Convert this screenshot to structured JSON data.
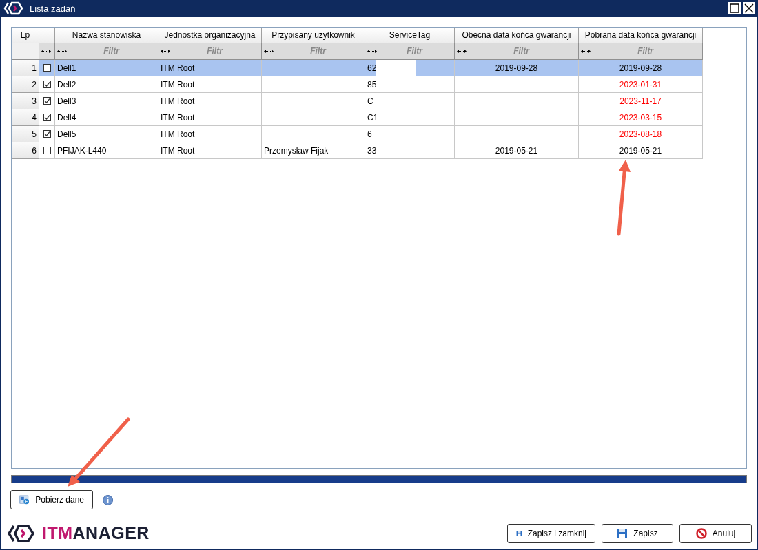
{
  "window": {
    "title": "Lista zadań"
  },
  "table": {
    "columns": [
      "Lp",
      "Nazwa stanowiska",
      "Jednostka organizacyjna",
      "Przypisany użytkownik",
      "ServiceTag",
      "Obecna data końca gwarancji",
      "Pobrana data końca gwarancji"
    ],
    "filter_placeholders": [
      "Filtr",
      "Filtr",
      "Filtr",
      "Filtr",
      "Filtr",
      "Filtr"
    ],
    "rows": [
      {
        "lp": "1",
        "checked": false,
        "selected": true,
        "name": "Dell1",
        "org": "ITM Root",
        "user": "",
        "tag": "62",
        "current": "2019-09-28",
        "fetched": "2019-09-28",
        "fetched_changed": false
      },
      {
        "lp": "2",
        "checked": true,
        "selected": false,
        "name": "Dell2",
        "org": "ITM Root",
        "user": "",
        "tag": "85",
        "current": "",
        "fetched": "2023-01-31",
        "fetched_changed": true
      },
      {
        "lp": "3",
        "checked": true,
        "selected": false,
        "name": "Dell3",
        "org": "ITM Root",
        "user": "",
        "tag": "C",
        "current": "",
        "fetched": "2023-11-17",
        "fetched_changed": true
      },
      {
        "lp": "4",
        "checked": true,
        "selected": false,
        "name": "Dell4",
        "org": "ITM Root",
        "user": "",
        "tag": "C1",
        "current": "",
        "fetched": "2023-03-15",
        "fetched_changed": true
      },
      {
        "lp": "5",
        "checked": true,
        "selected": false,
        "name": "Dell5",
        "org": "ITM Root",
        "user": "",
        "tag": "6",
        "current": "",
        "fetched": "2023-08-18",
        "fetched_changed": true
      },
      {
        "lp": "6",
        "checked": false,
        "selected": false,
        "name": "PFIJAK-L440",
        "org": "ITM Root",
        "user": "Przemysław Fijak",
        "tag": "33",
        "current": "2019-05-21",
        "fetched": "2019-05-21",
        "fetched_changed": false
      }
    ]
  },
  "progress": {
    "level": 1
  },
  "fetch_button": "Pobierz dane",
  "logo": {
    "accent": "ITM",
    "rest": "ANAGER"
  },
  "buttons": [
    {
      "kind": "save-close",
      "label": "Zapisz i zamknij"
    },
    {
      "kind": "save",
      "label": "Zapisz"
    },
    {
      "kind": "cancel",
      "label": "Anuluj"
    }
  ]
}
